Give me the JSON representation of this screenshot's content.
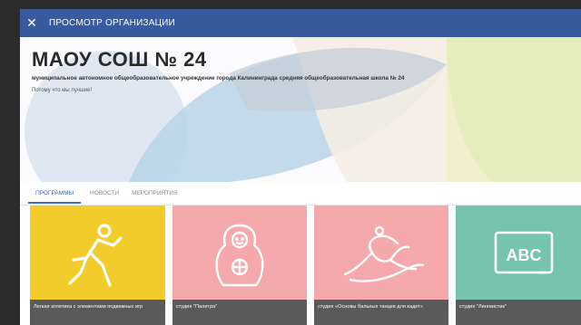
{
  "header": {
    "title": "ПРОСМОТР ОРГАНИЗАЦИИ",
    "close_icon": "close-icon",
    "color": "#3a5a9e"
  },
  "organization": {
    "name": "МАОУ СОШ № 24",
    "full_name": "муниципальное автономное общеобразовательное учреждение города Калининграда средняя общеобразовательная школа № 24",
    "slogan": "Потому что мы лучшие!"
  },
  "tabs": [
    {
      "label": "ПРОГРАММЫ",
      "active": true
    },
    {
      "label": "НОВОСТИ",
      "active": false
    },
    {
      "label": "МЕРОПРИЯТИЯ",
      "active": false
    }
  ],
  "accent_color": "#3b67c9",
  "programs": [
    {
      "title": "Легкая атлетика с элементами подвижных игр",
      "icon": "runner-icon",
      "color": "#f2cc2a"
    },
    {
      "title": "студия \"Палитра\"",
      "icon": "matryoshka-icon",
      "color": "#f5a9ad"
    },
    {
      "title": "студия «Основы бальных танцев для кадет»",
      "icon": "dancer-icon",
      "color": "#f5a9ad"
    },
    {
      "title": "студия \"Лингвистик\"",
      "icon": "chalkboard-abc-icon",
      "color": "#76c3ae",
      "board_text": "ABC"
    }
  ]
}
